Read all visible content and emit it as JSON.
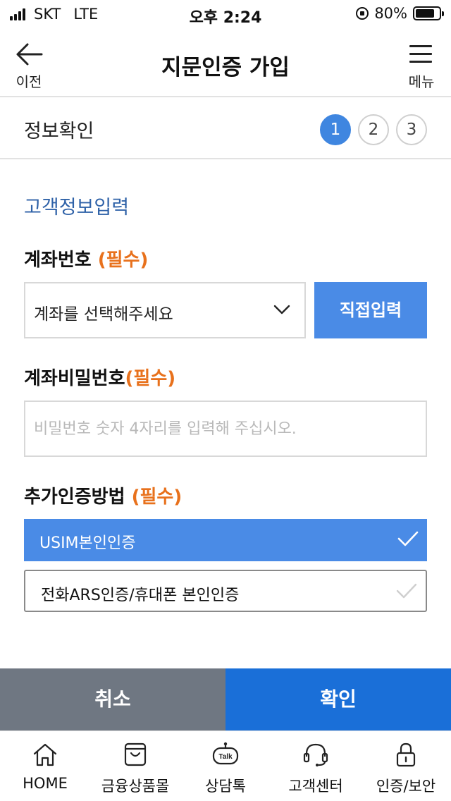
{
  "status_bar": {
    "carrier": "SKT",
    "network": "LTE",
    "time": "오후 2:24",
    "battery_percent": "80%",
    "battery_level": 0.8,
    "icons": [
      "signal-icon",
      "rotation-lock-icon",
      "battery-icon"
    ]
  },
  "header": {
    "back_label": "이전",
    "title": "지문인증 가입",
    "menu_label": "메뉴"
  },
  "steps": {
    "title": "정보확인",
    "items": [
      "1",
      "2",
      "3"
    ],
    "active_index": 0
  },
  "form": {
    "section_title": "고객정보입력",
    "account": {
      "label": "계좌번호",
      "required": "(필수)",
      "select_value": "계좌를 선택해주세요",
      "direct_button": "직접입력"
    },
    "password": {
      "label": "계좌비밀번호",
      "required": "(필수)",
      "placeholder": "비밀번호 숫자 4자리를 입력해 주십시오."
    },
    "auth_method": {
      "label": "추가인증방법",
      "required": "(필수)",
      "options": [
        {
          "label": "USIM본인인증",
          "selected": true
        },
        {
          "label": "전화ARS인증/휴대폰 본인인증",
          "selected": false
        }
      ]
    }
  },
  "actions": {
    "cancel": "취소",
    "confirm": "확인"
  },
  "colors": {
    "accent_blue": "#4a8be6",
    "confirm_blue": "#1a6fd8",
    "cancel_gray": "#6f7782",
    "required_orange": "#e8711c",
    "section_title_blue": "#2f62a8"
  },
  "tab_bar": {
    "items": [
      {
        "label": "HOME",
        "icon": "home-icon"
      },
      {
        "label": "금융상품몰",
        "icon": "shopping-bag-icon"
      },
      {
        "label": "상담톡",
        "icon": "talk-chat-icon"
      },
      {
        "label": "고객센터",
        "icon": "headset-icon"
      },
      {
        "label": "인증/보안",
        "icon": "lock-icon"
      }
    ],
    "talk_icon_text": "Talk"
  }
}
